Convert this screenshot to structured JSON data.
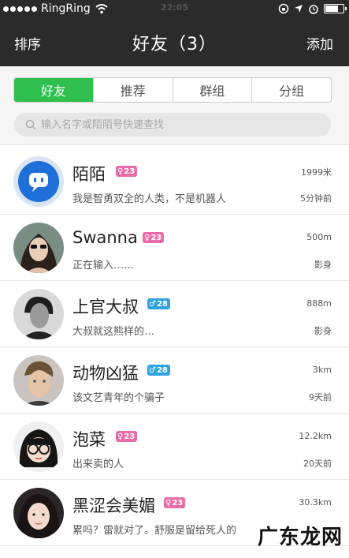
{
  "status_bar": {
    "carrier": "RingRing",
    "time": "22:05",
    "battery_level": 0.8,
    "icons": [
      "signal-dots-icon",
      "wifi-icon",
      "rotation-lock-icon",
      "location-arrow-icon",
      "alarm-icon",
      "battery-icon"
    ]
  },
  "nav": {
    "left_label": "排序",
    "title": "好友（3）",
    "right_label": "添加"
  },
  "tabs": [
    {
      "label": "好友",
      "active": true
    },
    {
      "label": "推荐",
      "active": false
    },
    {
      "label": "群组",
      "active": false
    },
    {
      "label": "分组",
      "active": false
    }
  ],
  "search": {
    "placeholder": "输入名字或陌陌号快速查找",
    "icon": "search-icon"
  },
  "friends": [
    {
      "name": "陌陌",
      "gender": "female",
      "age": "23",
      "signature": "我是智勇双全的人类，不是机器人",
      "distance": "1999米",
      "time": "5分钟前"
    },
    {
      "name": "Swanna",
      "gender": "female",
      "age": "23",
      "signature": "正在输入……",
      "distance": "500m",
      "time": "影身"
    },
    {
      "name": "上官大叔",
      "gender": "male",
      "age": "28",
      "signature": "大叔就这熊样的…",
      "distance": "888m",
      "time": "影身"
    },
    {
      "name": "动物凶猛",
      "gender": "male",
      "age": "28",
      "signature": "该文艺青年的个骗子",
      "distance": "3km",
      "time": "9天前"
    },
    {
      "name": "泡菜",
      "gender": "female",
      "age": "23",
      "signature": "出来卖的人",
      "distance": "12.2km",
      "time": "20天前"
    },
    {
      "name": "黑涩会美媚",
      "gender": "female",
      "age": "23",
      "signature": "累吗？雷就对了。舒服是留给死人的",
      "distance": "30.3km",
      "time": ""
    }
  ],
  "watermark": "广东龙网",
  "colors": {
    "bar": "#2b2b2b",
    "accent_green": "#2ebf4f",
    "female_badge": "#e96ba7",
    "male_badge": "#2fa3df"
  }
}
